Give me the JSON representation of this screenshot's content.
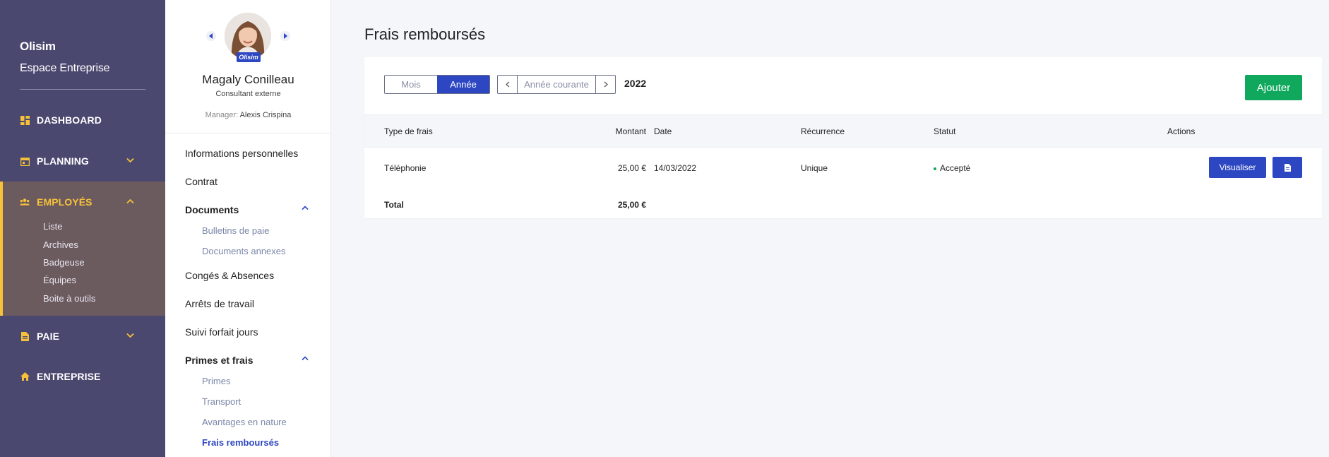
{
  "brand": {
    "name": "Olisim",
    "subtitle": "Espace Entreprise"
  },
  "nav": {
    "dashboard": {
      "label": "DASHBOARD",
      "icon": "dashboard-icon"
    },
    "planning": {
      "label": "PLANNING",
      "icon": "calendar-icon"
    },
    "employes": {
      "label": "EMPLOYÉS",
      "icon": "users-icon"
    },
    "paie": {
      "label": "PAIE",
      "icon": "document-icon"
    },
    "entreprise": {
      "label": "ENTREPRISE",
      "icon": "home-icon"
    },
    "employes_sub": [
      "Liste",
      "Archives",
      "Badgeuse",
      "Équipes",
      "Boite à outils"
    ]
  },
  "employee": {
    "name": "Magaly Conilleau",
    "role": "Consultant externe",
    "manager_label": "Manager:",
    "manager_name": "Alexis Crispina",
    "badge": "Olisim"
  },
  "panel_menu": {
    "infos": "Informations personnelles",
    "contrat": "Contrat",
    "documents": "Documents",
    "documents_sub": [
      "Bulletins de paie",
      "Documents annexes"
    ],
    "conges": "Congés & Absences",
    "arrets": "Arrêts de travail",
    "forfait": "Suivi forfait jours",
    "primes": "Primes et frais",
    "primes_sub": [
      "Primes",
      "Transport",
      "Avantages en nature",
      "Frais remboursés"
    ]
  },
  "page": {
    "title": "Frais remboursés",
    "toggle": [
      "Mois",
      "Année"
    ],
    "toggle_selected": "Année",
    "period_value": "Année courante",
    "year": "2022",
    "add_label": "Ajouter"
  },
  "table": {
    "headers": [
      "Type de frais",
      "Montant",
      "Date",
      "Récurrence",
      "Statut",
      "Actions"
    ],
    "rows": [
      {
        "type": "Téléphonie",
        "montant": "25,00 €",
        "date": "14/03/2022",
        "recurrence": "Unique",
        "statut": "Accepté"
      }
    ],
    "total_label": "Total",
    "total_value": "25,00 €",
    "view_label": "Visualiser"
  },
  "colors": {
    "sidebar": "#4b4870",
    "accent": "#f7c23a",
    "primary": "#2d47c2",
    "success": "#0fa85c"
  }
}
